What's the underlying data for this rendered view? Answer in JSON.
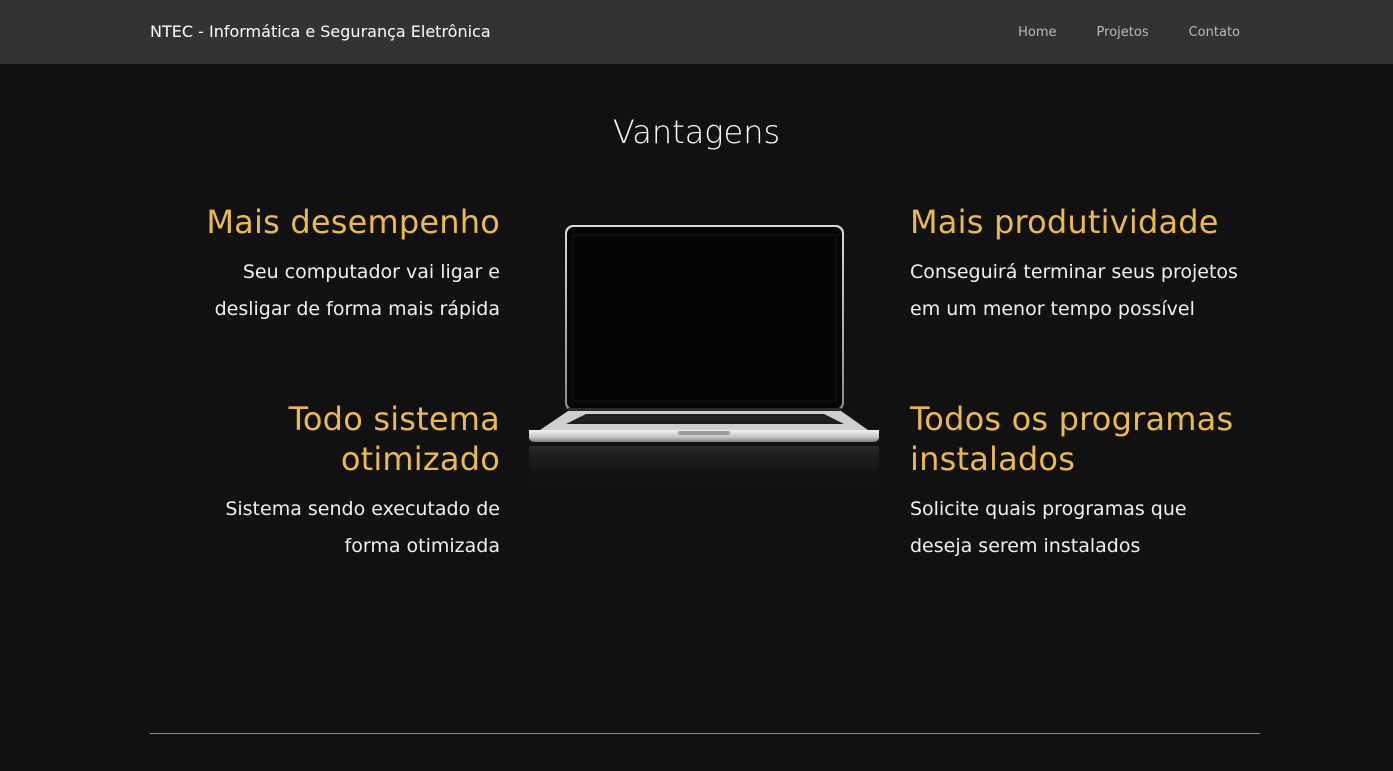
{
  "nav": {
    "brand": "NTEC - Informática e Segurança Eletrônica",
    "links": [
      "Home",
      "Projetos",
      "Contato"
    ]
  },
  "section": {
    "title": "Vantagens"
  },
  "features": [
    {
      "title": "Mais desempenho",
      "text": "Seu computador vai ligar e desligar de forma mais rápida"
    },
    {
      "title": "Todo sistema otimizado",
      "text": "Sistema sendo executado de forma otimizada"
    },
    {
      "title": "Mais produtividade",
      "text": "Conseguirá terminar seus projetos em um menor tempo possível"
    },
    {
      "title": "Todos os programas instalados",
      "text": "Solicite quais programas que deseja serem instalados"
    }
  ],
  "colors": {
    "background": "#111111",
    "navbar": "#333333",
    "accent": "#ebb94c",
    "divider": "#b08d3c"
  },
  "images": {
    "hero_icon": "laptop-icon"
  }
}
